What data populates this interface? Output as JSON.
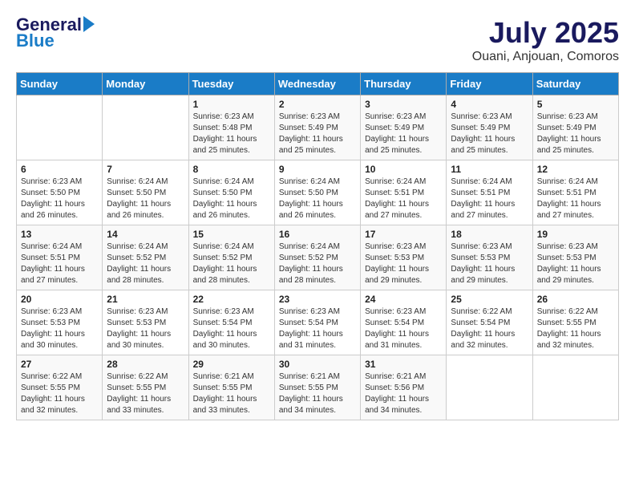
{
  "header": {
    "logo_general": "General",
    "logo_blue": "Blue",
    "month_title": "July 2025",
    "location": "Ouani, Anjouan, Comoros"
  },
  "days_of_week": [
    "Sunday",
    "Monday",
    "Tuesday",
    "Wednesday",
    "Thursday",
    "Friday",
    "Saturday"
  ],
  "weeks": [
    [
      {
        "day": "",
        "info": ""
      },
      {
        "day": "",
        "info": ""
      },
      {
        "day": "1",
        "info": "Sunrise: 6:23 AM\nSunset: 5:48 PM\nDaylight: 11 hours and 25 minutes."
      },
      {
        "day": "2",
        "info": "Sunrise: 6:23 AM\nSunset: 5:49 PM\nDaylight: 11 hours and 25 minutes."
      },
      {
        "day": "3",
        "info": "Sunrise: 6:23 AM\nSunset: 5:49 PM\nDaylight: 11 hours and 25 minutes."
      },
      {
        "day": "4",
        "info": "Sunrise: 6:23 AM\nSunset: 5:49 PM\nDaylight: 11 hours and 25 minutes."
      },
      {
        "day": "5",
        "info": "Sunrise: 6:23 AM\nSunset: 5:49 PM\nDaylight: 11 hours and 25 minutes."
      }
    ],
    [
      {
        "day": "6",
        "info": "Sunrise: 6:23 AM\nSunset: 5:50 PM\nDaylight: 11 hours and 26 minutes."
      },
      {
        "day": "7",
        "info": "Sunrise: 6:24 AM\nSunset: 5:50 PM\nDaylight: 11 hours and 26 minutes."
      },
      {
        "day": "8",
        "info": "Sunrise: 6:24 AM\nSunset: 5:50 PM\nDaylight: 11 hours and 26 minutes."
      },
      {
        "day": "9",
        "info": "Sunrise: 6:24 AM\nSunset: 5:50 PM\nDaylight: 11 hours and 26 minutes."
      },
      {
        "day": "10",
        "info": "Sunrise: 6:24 AM\nSunset: 5:51 PM\nDaylight: 11 hours and 27 minutes."
      },
      {
        "day": "11",
        "info": "Sunrise: 6:24 AM\nSunset: 5:51 PM\nDaylight: 11 hours and 27 minutes."
      },
      {
        "day": "12",
        "info": "Sunrise: 6:24 AM\nSunset: 5:51 PM\nDaylight: 11 hours and 27 minutes."
      }
    ],
    [
      {
        "day": "13",
        "info": "Sunrise: 6:24 AM\nSunset: 5:51 PM\nDaylight: 11 hours and 27 minutes."
      },
      {
        "day": "14",
        "info": "Sunrise: 6:24 AM\nSunset: 5:52 PM\nDaylight: 11 hours and 28 minutes."
      },
      {
        "day": "15",
        "info": "Sunrise: 6:24 AM\nSunset: 5:52 PM\nDaylight: 11 hours and 28 minutes."
      },
      {
        "day": "16",
        "info": "Sunrise: 6:24 AM\nSunset: 5:52 PM\nDaylight: 11 hours and 28 minutes."
      },
      {
        "day": "17",
        "info": "Sunrise: 6:23 AM\nSunset: 5:53 PM\nDaylight: 11 hours and 29 minutes."
      },
      {
        "day": "18",
        "info": "Sunrise: 6:23 AM\nSunset: 5:53 PM\nDaylight: 11 hours and 29 minutes."
      },
      {
        "day": "19",
        "info": "Sunrise: 6:23 AM\nSunset: 5:53 PM\nDaylight: 11 hours and 29 minutes."
      }
    ],
    [
      {
        "day": "20",
        "info": "Sunrise: 6:23 AM\nSunset: 5:53 PM\nDaylight: 11 hours and 30 minutes."
      },
      {
        "day": "21",
        "info": "Sunrise: 6:23 AM\nSunset: 5:53 PM\nDaylight: 11 hours and 30 minutes."
      },
      {
        "day": "22",
        "info": "Sunrise: 6:23 AM\nSunset: 5:54 PM\nDaylight: 11 hours and 30 minutes."
      },
      {
        "day": "23",
        "info": "Sunrise: 6:23 AM\nSunset: 5:54 PM\nDaylight: 11 hours and 31 minutes."
      },
      {
        "day": "24",
        "info": "Sunrise: 6:23 AM\nSunset: 5:54 PM\nDaylight: 11 hours and 31 minutes."
      },
      {
        "day": "25",
        "info": "Sunrise: 6:22 AM\nSunset: 5:54 PM\nDaylight: 11 hours and 32 minutes."
      },
      {
        "day": "26",
        "info": "Sunrise: 6:22 AM\nSunset: 5:55 PM\nDaylight: 11 hours and 32 minutes."
      }
    ],
    [
      {
        "day": "27",
        "info": "Sunrise: 6:22 AM\nSunset: 5:55 PM\nDaylight: 11 hours and 32 minutes."
      },
      {
        "day": "28",
        "info": "Sunrise: 6:22 AM\nSunset: 5:55 PM\nDaylight: 11 hours and 33 minutes."
      },
      {
        "day": "29",
        "info": "Sunrise: 6:21 AM\nSunset: 5:55 PM\nDaylight: 11 hours and 33 minutes."
      },
      {
        "day": "30",
        "info": "Sunrise: 6:21 AM\nSunset: 5:55 PM\nDaylight: 11 hours and 34 minutes."
      },
      {
        "day": "31",
        "info": "Sunrise: 6:21 AM\nSunset: 5:56 PM\nDaylight: 11 hours and 34 minutes."
      },
      {
        "day": "",
        "info": ""
      },
      {
        "day": "",
        "info": ""
      }
    ]
  ]
}
